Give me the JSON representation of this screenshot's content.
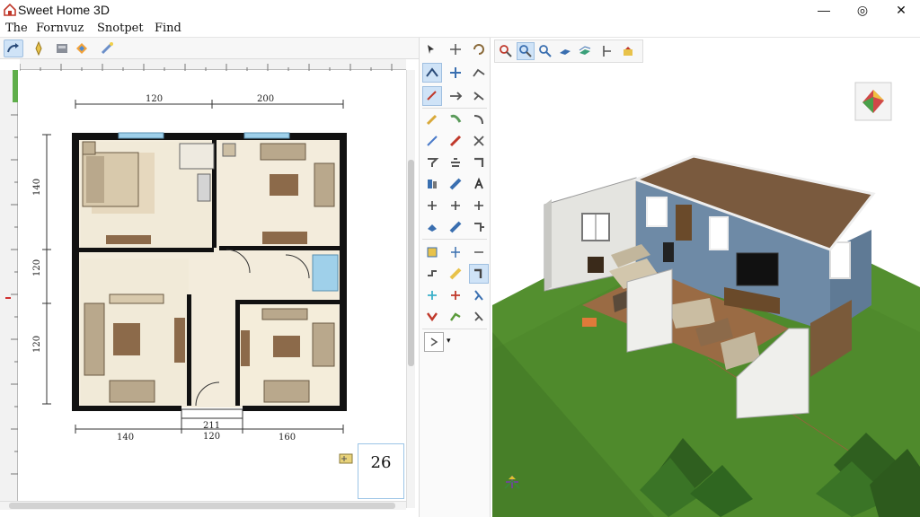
{
  "window": {
    "title": "Sweet Home 3D",
    "minimize_symbol": "—",
    "restore_symbol": "◎",
    "close_symbol": "✕"
  },
  "menu": {
    "items": [
      "The",
      "Fornvuz",
      "Snotpet",
      "Find"
    ]
  },
  "toolbar": {
    "icons": [
      "arrow-icon",
      "compass-icon",
      "furniture-icon",
      "import-icon",
      "wand-icon"
    ]
  },
  "plan": {
    "dimensions": {
      "top_left": "120",
      "top_right": "200",
      "left_top": "140",
      "left_middle": "120",
      "left_bottom": "120",
      "bottom_left": "140",
      "bottom_center_top": "211",
      "bottom_center_bottom": "120",
      "bottom_right": "160"
    }
  },
  "zoom": {
    "value": "26"
  },
  "colors": {
    "wall": "#111111",
    "floor_light": "#f3ecdc",
    "floor_tan": "#e8d9bf",
    "rug": "#e3d6bd",
    "sofa": "#b9a88c",
    "table": "#8c6a4a",
    "window": "#9fd0ea",
    "selection": "#cfe3f7",
    "grass": "#4f8a2c",
    "grass_dark": "#3f7424",
    "wall_blue": "#6e8aa6",
    "roof": "#7a5a3e",
    "floor_wood": "#9a6b44"
  }
}
